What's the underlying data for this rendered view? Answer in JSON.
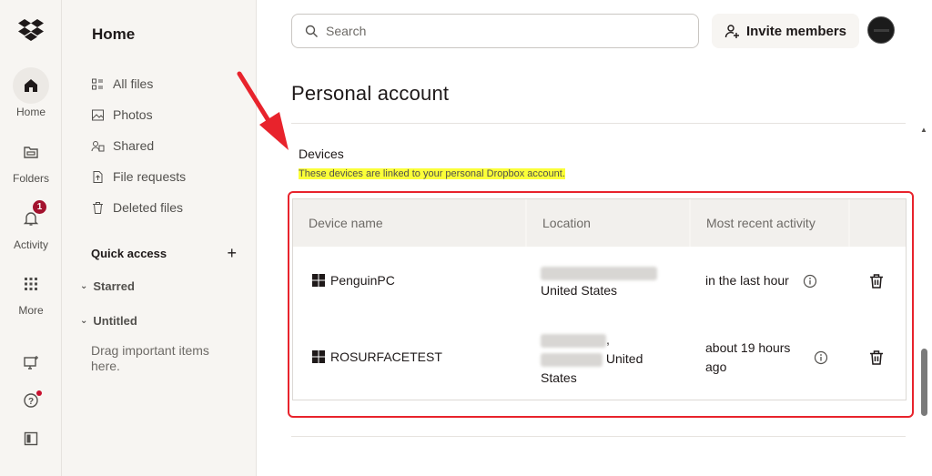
{
  "rail": {
    "home_label": "Home",
    "folders_label": "Folders",
    "activity_label": "Activity",
    "activity_badge": "1",
    "more_label": "More"
  },
  "sidebar": {
    "title": "Home",
    "items": [
      {
        "label": "All files",
        "icon": "all-files-icon"
      },
      {
        "label": "Photos",
        "icon": "photos-icon"
      },
      {
        "label": "Shared",
        "icon": "shared-icon"
      },
      {
        "label": "File requests",
        "icon": "file-requests-icon"
      },
      {
        "label": "Deleted files",
        "icon": "trash-icon"
      }
    ],
    "quick_access": "Quick access",
    "quick_access_add": "+",
    "starred": "Starred",
    "untitled": "Untitled",
    "drag_hint": "Drag important items here."
  },
  "header": {
    "search_placeholder": "Search",
    "invite_label": "Invite members"
  },
  "page": {
    "title": "Personal account",
    "devices_title": "Devices",
    "devices_subtitle": "These devices are linked to your personal Dropbox account."
  },
  "table": {
    "columns": [
      "Device name",
      "Location",
      "Most recent activity"
    ],
    "rows": [
      {
        "name": "PenguinPC",
        "location": "United States",
        "activity": "in the last hour"
      },
      {
        "name": "ROSURFACETEST",
        "location_a": "United",
        "location_b": "States",
        "activity": "about 19 hours ago"
      }
    ]
  },
  "colors": {
    "accent_annotation": "#e8232c",
    "highlight": "#fbff38",
    "badge": "#a3122e"
  }
}
